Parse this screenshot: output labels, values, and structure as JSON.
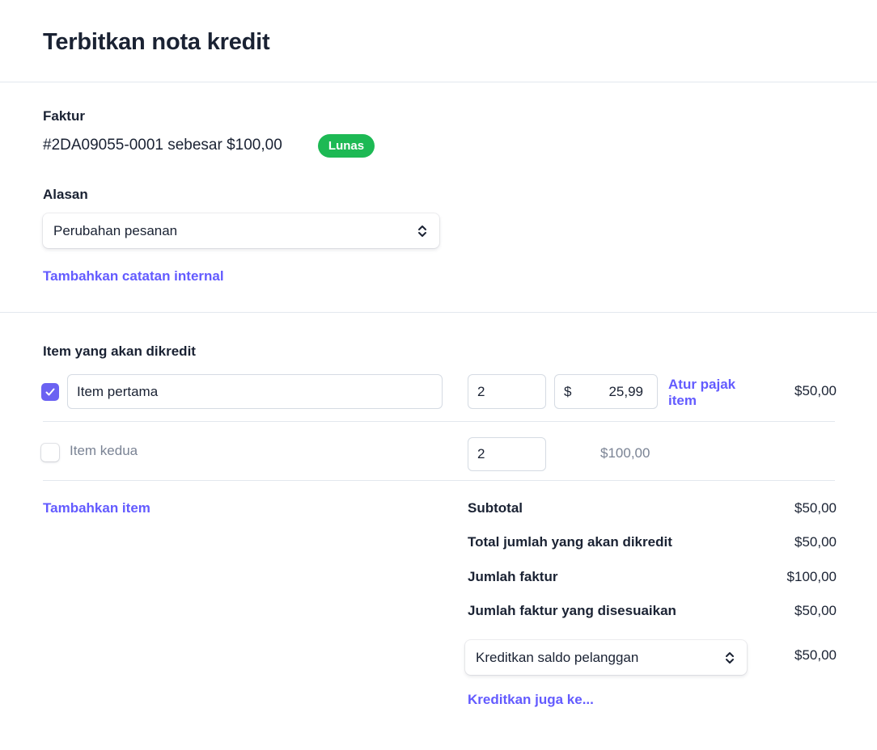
{
  "page": {
    "title": "Terbitkan nota kredit"
  },
  "invoice": {
    "label": "Faktur",
    "text": "#2DA09055-0001 sebesar $100,00",
    "status": "Lunas"
  },
  "reason": {
    "label": "Alasan",
    "selected": "Perubahan pesanan"
  },
  "add_note_link": "Tambahkan catatan internal",
  "items_section": {
    "label": "Item yang akan dikredit",
    "items": [
      {
        "checked": true,
        "name": "Item pertama",
        "quantity": "2",
        "currency": "$",
        "unit_price": "25,99",
        "tax_link": "Atur pajak item",
        "amount": "$50,00"
      },
      {
        "checked": false,
        "name": "Item kedua",
        "quantity": "2",
        "price": "$100,00"
      }
    ],
    "add_item_link": "Tambahkan item"
  },
  "summary": {
    "rows": [
      {
        "label": "Subtotal",
        "value": "$50,00"
      },
      {
        "label": "Total jumlah yang akan dikredit",
        "value": "$50,00"
      },
      {
        "label": "Jumlah faktur",
        "value": "$100,00"
      },
      {
        "label": "Jumlah faktur yang disesuaikan",
        "value": "$50,00"
      }
    ],
    "credit_method": "Kreditkan saldo pelanggan",
    "credit_amount": "$50,00",
    "credit_also_link": "Kreditkan juga ke..."
  },
  "colors": {
    "accent": "#635bff",
    "status_paid": "#1db954",
    "checkbox_checked": "#6b62f2"
  }
}
